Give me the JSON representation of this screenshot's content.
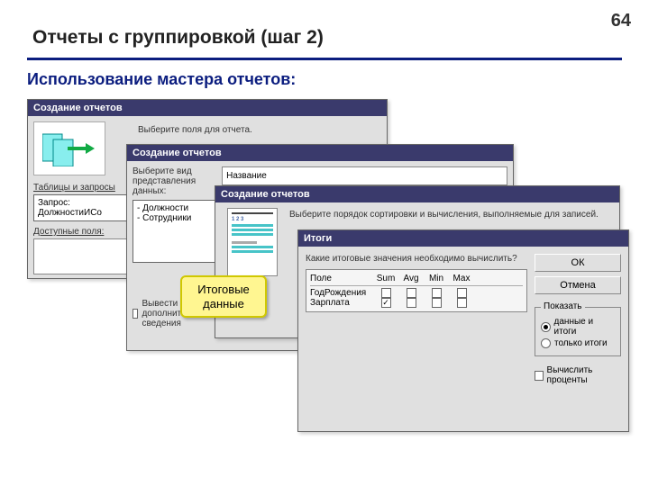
{
  "page_number": "64",
  "title": "Отчеты с группировкой (шаг 2)",
  "subtitle": "Использование мастера отчетов:",
  "callout": "Итоговые\nданные",
  "win1": {
    "title": "Создание отчетов",
    "instruction": "Выберите поля для отчета.",
    "tables_label": "Таблицы и запросы",
    "tables_value": "Запрос: ДолжностиИСо",
    "available_label": "Доступные поля:"
  },
  "win2": {
    "title": "Создание отчетов",
    "instruction": "Выберите вид представления данных:",
    "list": [
      "- Должности",
      "- Сотрудники"
    ],
    "checkbox_label": "Вывести дополнительные сведения",
    "preview_field": "Название"
  },
  "win3": {
    "title": "Создание отчетов",
    "instruction": "Выберите порядок сортировки и вычисления, выполняемые для записей."
  },
  "win4": {
    "title": "Итоги",
    "instruction": "Какие итоговые значения необходимо вычислить?",
    "columns": [
      "Поле",
      "Sum",
      "Avg",
      "Min",
      "Max"
    ],
    "rows": [
      {
        "name": "ГодРождения",
        "sum": false,
        "avg": false,
        "min": false,
        "max": false
      },
      {
        "name": "Зарплата",
        "sum": true,
        "avg": false,
        "min": false,
        "max": false
      }
    ],
    "ok": "ОК",
    "cancel": "Отмена",
    "group_show": "Показать",
    "opt_data_totals": "данные и итоги",
    "opt_totals_only": "только итоги",
    "calc_percent": "Вычислить проценты"
  }
}
